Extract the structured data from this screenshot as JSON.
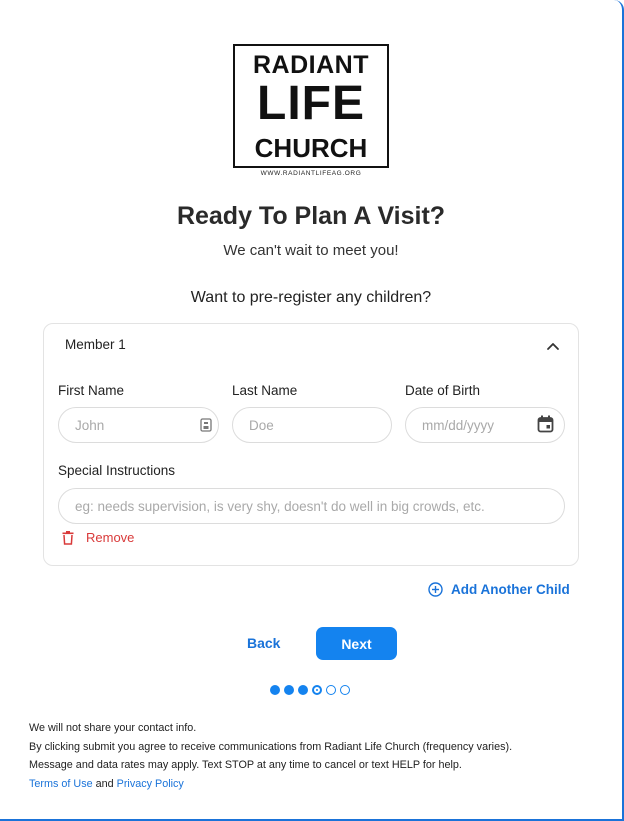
{
  "logo": {
    "line1": "RADIANT",
    "line2": "LIFE",
    "line3": "CHURCH",
    "url": "WWW.RADIANTLIFEAG.ORG"
  },
  "header": {
    "title": "Ready To Plan A Visit?",
    "subtitle": "We can't wait to meet you!",
    "question": "Want to pre-register any children?"
  },
  "member": {
    "title": "Member 1",
    "first_name_label": "First Name",
    "first_name_placeholder": "John",
    "last_name_label": "Last Name",
    "last_name_placeholder": "Doe",
    "dob_label": "Date of Birth",
    "dob_placeholder": "mm/dd/yyyy",
    "special_label": "Special Instructions",
    "special_placeholder": "eg: needs supervision, is very shy, doesn't do well in big crowds, etc.",
    "remove_label": "Remove"
  },
  "actions": {
    "add_child": "Add Another Child",
    "back": "Back",
    "next": "Next"
  },
  "progress": {
    "total_steps": 6,
    "current_step": 4
  },
  "footer": {
    "line1": "We will not share your contact info.",
    "line2": "By clicking submit you agree to receive communications from Radiant Life Church (frequency varies).",
    "line3": "Message and data rates may apply. Text STOP at any time to cancel or text HELP for help.",
    "terms": "Terms of Use",
    "and": "and",
    "privacy": "Privacy Policy"
  },
  "colors": {
    "accent": "#1483ef",
    "link": "#1a73d9",
    "danger": "#d93a3a"
  }
}
